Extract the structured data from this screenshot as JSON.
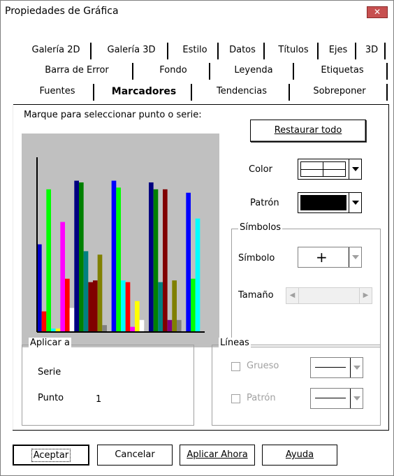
{
  "window": {
    "title": "Propiedades de Gráfica",
    "close_glyph": "✕"
  },
  "tabs": {
    "row1": [
      "Galería 2D",
      "Galería 3D",
      "Estilo",
      "Datos",
      "Títulos",
      "Ejes",
      "3D"
    ],
    "row2": [
      "Barra de Error",
      "Fondo",
      "Leyenda",
      "Etiquetas"
    ],
    "row3": [
      "Fuentes",
      "Marcadores",
      "Tendencias",
      "Sobreponer"
    ],
    "active": "Marcadores"
  },
  "panel": {
    "instruction": "Marque para seleccionar punto o serie:",
    "restore_button": "Restaurar todo",
    "color_label": "Color",
    "pattern_label": "Patrón",
    "symbols_group": "Símbolos",
    "symbol_label": "Símbolo",
    "symbol_value": "+",
    "size_label": "Tamaño",
    "apply_group": "Aplicar a",
    "series_label": "Serie",
    "point_label": "Punto",
    "point_value": "1",
    "lines_group": "Líneas",
    "thick_label": "Grueso",
    "line_pattern_label": "Patrón"
  },
  "buttons": {
    "accept": "Aceptar",
    "cancel": "Cancelar",
    "apply_now": "Aplicar Ahora",
    "help": "Ayuda"
  },
  "chart_data": {
    "type": "bar",
    "ylim": [
      0,
      100
    ],
    "groups": [
      [
        {
          "v": 51,
          "c": "#0000c8"
        },
        {
          "v": 12,
          "c": "#ff0000"
        },
        {
          "v": 83,
          "c": "#00ff00"
        },
        {
          "v": 2,
          "c": "#00ffff"
        }
      ],
      [
        {
          "v": 2,
          "c": "#ffff00"
        },
        {
          "v": 64,
          "c": "#ff00ff"
        },
        {
          "v": 31,
          "c": "#ff0000"
        },
        {
          "v": 14,
          "c": "#ffffff"
        }
      ],
      [
        {
          "v": 88,
          "c": "#000080"
        },
        {
          "v": 87,
          "c": "#008000"
        },
        {
          "v": 47,
          "c": "#008080"
        },
        {
          "v": 29,
          "c": "#800000"
        }
      ],
      [
        {
          "v": 30,
          "c": "#800000"
        },
        {
          "v": 45,
          "c": "#808000"
        },
        {
          "v": 4,
          "c": "#808080"
        },
        {
          "v": 2,
          "c": "#c0c0c0"
        }
      ],
      [
        {
          "v": 88,
          "c": "#0000ff"
        },
        {
          "v": 84,
          "c": "#00ff00"
        },
        {
          "v": 30,
          "c": "#00ffff"
        },
        {
          "v": 29,
          "c": "#ff0000"
        }
      ],
      [
        {
          "v": 3,
          "c": "#ff00ff"
        },
        {
          "v": 18,
          "c": "#ffff00"
        },
        {
          "v": 7,
          "c": "#ffffff"
        },
        {
          "v": 2,
          "c": "#c0c0c0"
        }
      ],
      [
        {
          "v": 87,
          "c": "#000080"
        },
        {
          "v": 83,
          "c": "#008000"
        },
        {
          "v": 29,
          "c": "#008080"
        },
        {
          "v": 83,
          "c": "#800000"
        }
      ],
      [
        {
          "v": 7,
          "c": "#800080"
        },
        {
          "v": 30,
          "c": "#808000"
        },
        {
          "v": 7,
          "c": "#808080"
        },
        {
          "v": 2,
          "c": "#c0c0c0"
        }
      ],
      [
        {
          "v": 81,
          "c": "#0000ff"
        },
        {
          "v": 31,
          "c": "#00ff00"
        },
        {
          "v": 66,
          "c": "#00ffff"
        },
        {
          "v": 2,
          "c": "#c0c0c0"
        }
      ]
    ]
  }
}
